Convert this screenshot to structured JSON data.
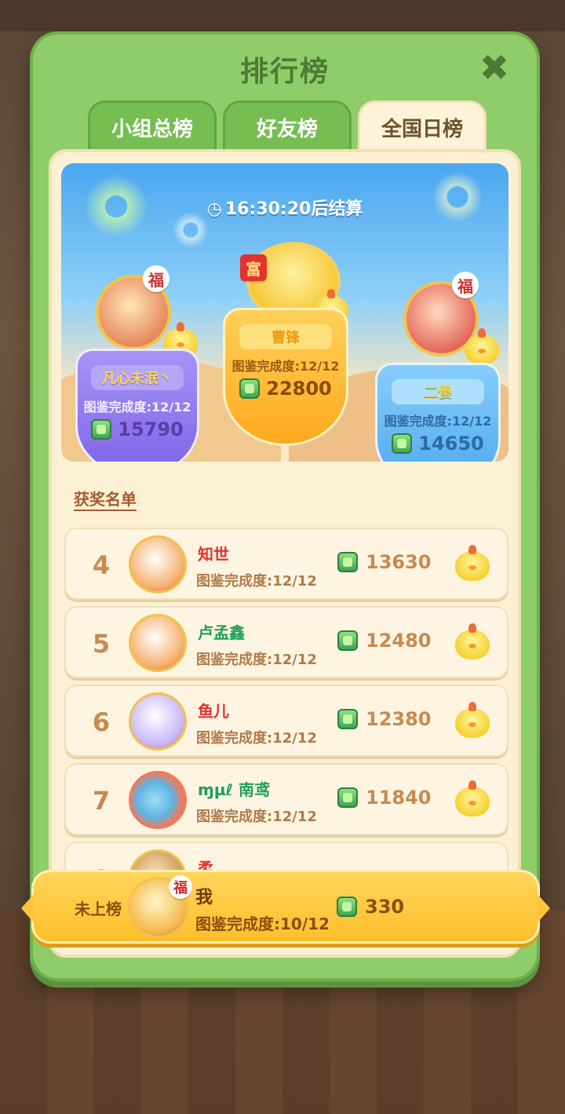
{
  "modal": {
    "title": "排行榜",
    "close_icon": "close-icon"
  },
  "tabs": [
    {
      "label": "小组总榜",
      "active": false
    },
    {
      "label": "好友榜",
      "active": false
    },
    {
      "label": "全国日榜",
      "active": true
    }
  ],
  "timer": {
    "icon": "clock-icon",
    "text": "16:30:20后结算"
  },
  "podium": {
    "first": {
      "name": "曹锋",
      "progress": "图鉴完成度:12/12",
      "score": "22800",
      "badge": "富"
    },
    "second": {
      "name": "凡心未泯丶",
      "progress": "图鉴完成度:12/12",
      "score": "15790",
      "badge": "福"
    },
    "third": {
      "name": "二傻",
      "progress": "图鉴完成度:12/12",
      "score": "14650",
      "badge": "福"
    }
  },
  "awards_title": "获奖名单",
  "list": [
    {
      "rank": "4",
      "name": "知世",
      "name_color": "#e2322c",
      "progress": "图鉴完成度:12/12",
      "score": "13630"
    },
    {
      "rank": "5",
      "name": "卢孟鑫",
      "name_color": "#1f9e5a",
      "progress": "图鉴完成度:12/12",
      "score": "12480"
    },
    {
      "rank": "6",
      "name": "鱼儿",
      "name_color": "#e2322c",
      "progress": "图鉴完成度:12/12",
      "score": "12380"
    },
    {
      "rank": "7",
      "name": "ɱµℓ 南鸢",
      "name_color": "#1f9e5a",
      "progress": "图鉴完成度:12/12",
      "score": "11840"
    },
    {
      "rank": "8",
      "name": "柔",
      "name_color": "#e2322c",
      "progress": "",
      "score": ""
    }
  ],
  "me": {
    "status": "未上榜",
    "name": "我",
    "progress": "图鉴完成度:10/12",
    "score": "330"
  },
  "icons": {
    "currency": "fish-tank-coin-icon",
    "reward": "chick-icon"
  }
}
